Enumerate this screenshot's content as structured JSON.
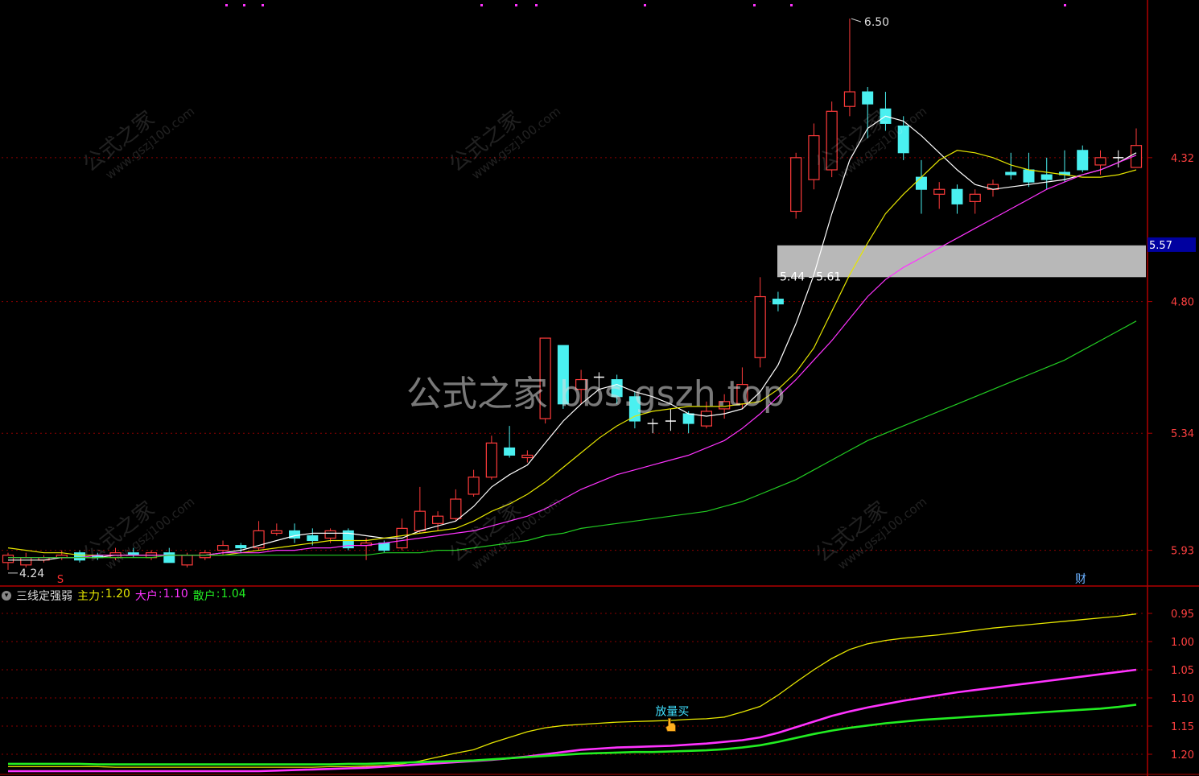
{
  "main_panel": {
    "axis_labels": [
      "5.93",
      "5.34",
      "4.80",
      "4.32"
    ],
    "current_price_tag": "5.57",
    "high_label": "6.50",
    "low_label": "4.24",
    "zone_label": "5.44 - 5.61",
    "zone": [
      5.44,
      5.61
    ],
    "marker_s": "S",
    "marker_cai": "财"
  },
  "sub_panel": {
    "indicator_name": "三线定强弱",
    "series_legend": [
      {
        "label": "主力",
        "value": "1.20",
        "color": "#e6e600"
      },
      {
        "label": "大户",
        "value": "1.10",
        "color": "#ff33ff"
      },
      {
        "label": "散户",
        "value": "1.04",
        "color": "#22ee22"
      }
    ],
    "axis_labels": [
      "1.20",
      "1.15",
      "1.10",
      "1.05",
      "1.00",
      "0.95"
    ],
    "signal_label": "放量买"
  },
  "watermarks": {
    "small_title": "公式之家",
    "small_url": "www.gszj100.com",
    "center_text": "公式之家 bbs.gszh.top"
  },
  "colors": {
    "up": "#ff3b3b",
    "down": "#4af0f0",
    "ma5": "#ffffff",
    "ma10": "#e6e600",
    "ma20": "#ff33ff",
    "ma60": "#22cc22",
    "grid": "#8a0000",
    "zone": "#c8c8c8"
  },
  "chart_data": [
    {
      "type": "candlestick",
      "title": "",
      "ylim": [
        4.2,
        6.55
      ],
      "axis_ticks": [
        4.32,
        4.8,
        5.34,
        5.93
      ],
      "candles": [
        [
          4.27,
          4.3,
          4.31,
          4.24
        ],
        [
          4.26,
          4.29,
          4.31,
          4.25
        ],
        [
          4.28,
          4.29,
          4.3,
          4.27
        ],
        [
          4.29,
          4.3,
          4.32,
          4.28
        ],
        [
          4.31,
          4.28,
          4.32,
          4.27
        ],
        [
          4.3,
          4.29,
          4.31,
          4.28
        ],
        [
          4.29,
          4.31,
          4.33,
          4.28
        ],
        [
          4.31,
          4.3,
          4.33,
          4.29
        ],
        [
          4.29,
          4.31,
          4.32,
          4.28
        ],
        [
          4.31,
          4.27,
          4.33,
          4.27
        ],
        [
          4.26,
          4.3,
          4.31,
          4.25
        ],
        [
          4.29,
          4.31,
          4.32,
          4.28
        ],
        [
          4.32,
          4.34,
          4.36,
          4.3
        ],
        [
          4.34,
          4.33,
          4.35,
          4.31
        ],
        [
          4.33,
          4.4,
          4.44,
          4.32
        ],
        [
          4.39,
          4.4,
          4.43,
          4.38
        ],
        [
          4.4,
          4.37,
          4.43,
          4.35
        ],
        [
          4.38,
          4.36,
          4.41,
          4.34
        ],
        [
          4.37,
          4.4,
          4.41,
          4.35
        ],
        [
          4.4,
          4.33,
          4.41,
          4.32
        ],
        [
          4.34,
          4.35,
          4.37,
          4.28
        ],
        [
          4.35,
          4.32,
          4.36,
          4.31
        ],
        [
          4.33,
          4.41,
          4.45,
          4.32
        ],
        [
          4.4,
          4.48,
          4.58,
          4.39
        ],
        [
          4.43,
          4.46,
          4.48,
          4.4
        ],
        [
          4.45,
          4.53,
          4.57,
          4.44
        ],
        [
          4.55,
          4.62,
          4.65,
          4.54
        ],
        [
          4.62,
          4.76,
          4.79,
          4.61
        ],
        [
          4.74,
          4.71,
          4.83,
          4.7
        ],
        [
          4.7,
          4.71,
          4.73,
          4.68
        ],
        [
          4.86,
          5.19,
          5.19,
          4.84
        ],
        [
          5.16,
          4.92,
          5.16,
          4.9
        ],
        [
          4.98,
          5.02,
          5.06,
          4.92
        ],
        [
          5.03,
          5.03,
          5.05,
          4.98
        ],
        [
          5.02,
          4.95,
          5.04,
          4.92
        ],
        [
          4.95,
          4.85,
          4.97,
          4.82
        ],
        [
          4.84,
          4.84,
          4.86,
          4.8
        ],
        [
          4.85,
          4.85,
          4.9,
          4.81
        ],
        [
          4.88,
          4.84,
          4.89,
          4.8
        ],
        [
          4.83,
          4.89,
          4.93,
          4.82
        ],
        [
          4.9,
          4.93,
          4.96,
          4.86
        ],
        [
          4.92,
          5.0,
          5.07,
          4.9
        ],
        [
          5.11,
          5.36,
          5.44,
          5.07
        ],
        [
          5.35,
          5.33,
          5.38,
          5.3
        ],
        [
          5.71,
          5.93,
          5.95,
          5.68
        ],
        [
          5.84,
          6.02,
          6.07,
          5.8
        ],
        [
          5.88,
          6.12,
          6.16,
          5.85
        ],
        [
          6.14,
          6.2,
          6.5,
          6.1
        ],
        [
          6.2,
          6.15,
          6.22,
          6.01
        ],
        [
          6.13,
          6.07,
          6.2,
          6.04
        ],
        [
          6.06,
          5.95,
          6.1,
          5.92
        ],
        [
          5.85,
          5.8,
          5.92,
          5.7
        ],
        [
          5.78,
          5.8,
          5.83,
          5.72
        ],
        [
          5.8,
          5.74,
          5.82,
          5.7
        ],
        [
          5.75,
          5.78,
          5.8,
          5.7
        ],
        [
          5.8,
          5.82,
          5.84,
          5.77
        ],
        [
          5.87,
          5.86,
          5.95,
          5.84
        ],
        [
          5.88,
          5.83,
          5.95,
          5.81
        ],
        [
          5.86,
          5.84,
          5.93,
          5.8
        ],
        [
          5.87,
          5.86,
          5.96,
          5.83
        ],
        [
          5.96,
          5.88,
          5.98,
          5.87
        ],
        [
          5.9,
          5.93,
          5.96,
          5.86
        ],
        [
          5.93,
          5.93,
          5.96,
          5.89
        ],
        [
          5.89,
          5.98,
          6.05,
          5.89
        ]
      ],
      "ma_lines": [
        {
          "key": "ma5",
          "values": [
            4.28,
            4.28,
            4.28,
            4.29,
            4.29,
            4.29,
            4.3,
            4.3,
            4.3,
            4.3,
            4.3,
            4.3,
            4.31,
            4.32,
            4.34,
            4.36,
            4.38,
            4.39,
            4.39,
            4.39,
            4.38,
            4.37,
            4.37,
            4.4,
            4.42,
            4.44,
            4.5,
            4.58,
            4.63,
            4.67,
            4.76,
            4.85,
            4.92,
            4.98,
            5.0,
            4.97,
            4.95,
            4.92,
            4.88,
            4.87,
            4.88,
            4.9,
            4.97,
            5.08,
            5.25,
            5.45,
            5.7,
            5.92,
            6.05,
            6.1,
            6.08,
            6.02,
            5.95,
            5.88,
            5.82,
            5.8,
            5.81,
            5.82,
            5.83,
            5.84,
            5.86,
            5.88,
            5.91,
            5.95
          ]
        },
        {
          "key": "ma10",
          "values": [
            4.33,
            4.32,
            4.31,
            4.31,
            4.3,
            4.3,
            4.3,
            4.3,
            4.3,
            4.3,
            4.3,
            4.3,
            4.3,
            4.31,
            4.32,
            4.33,
            4.34,
            4.35,
            4.36,
            4.36,
            4.36,
            4.37,
            4.38,
            4.39,
            4.4,
            4.41,
            4.44,
            4.48,
            4.51,
            4.55,
            4.6,
            4.66,
            4.72,
            4.78,
            4.83,
            4.87,
            4.89,
            4.9,
            4.91,
            4.91,
            4.91,
            4.92,
            4.93,
            4.98,
            5.05,
            5.15,
            5.3,
            5.45,
            5.58,
            5.7,
            5.78,
            5.85,
            5.92,
            5.96,
            5.95,
            5.93,
            5.9,
            5.88,
            5.87,
            5.86,
            5.85,
            5.85,
            5.86,
            5.88
          ]
        },
        {
          "key": "ma20",
          "values": [
            4.29,
            4.29,
            4.29,
            4.29,
            4.29,
            4.3,
            4.3,
            4.3,
            4.3,
            4.3,
            4.3,
            4.3,
            4.31,
            4.31,
            4.31,
            4.32,
            4.32,
            4.33,
            4.33,
            4.34,
            4.34,
            4.35,
            4.36,
            4.37,
            4.38,
            4.39,
            4.4,
            4.42,
            4.44,
            4.46,
            4.49,
            4.53,
            4.57,
            4.6,
            4.63,
            4.65,
            4.67,
            4.69,
            4.71,
            4.74,
            4.77,
            4.82,
            4.88,
            4.95,
            5.02,
            5.1,
            5.18,
            5.27,
            5.36,
            5.43,
            5.48,
            5.52,
            5.56,
            5.6,
            5.64,
            5.68,
            5.72,
            5.76,
            5.8,
            5.83,
            5.86,
            5.88,
            5.91,
            5.94
          ]
        },
        {
          "key": "ma60",
          "values": [
            4.29,
            4.29,
            4.29,
            4.29,
            4.29,
            4.29,
            4.29,
            4.29,
            4.29,
            4.3,
            4.3,
            4.3,
            4.3,
            4.3,
            4.3,
            4.3,
            4.3,
            4.3,
            4.3,
            4.3,
            4.3,
            4.31,
            4.31,
            4.31,
            4.32,
            4.32,
            4.33,
            4.34,
            4.35,
            4.36,
            4.38,
            4.39,
            4.41,
            4.42,
            4.43,
            4.44,
            4.45,
            4.46,
            4.47,
            4.48,
            4.5,
            4.52,
            4.55,
            4.58,
            4.61,
            4.65,
            4.69,
            4.73,
            4.77,
            4.8,
            4.83,
            4.86,
            4.89,
            4.92,
            4.95,
            4.98,
            5.01,
            5.04,
            5.07,
            5.1,
            5.14,
            5.18,
            5.22,
            5.26
          ]
        }
      ]
    },
    {
      "type": "line",
      "title": "三线定强弱",
      "ylim": [
        0.92,
        1.22
      ],
      "axis_ticks": [
        0.95,
        1.0,
        1.05,
        1.1,
        1.15,
        1.2
      ],
      "series": [
        {
          "name": "主力",
          "key": "zl",
          "values": [
            0.928,
            0.928,
            0.928,
            0.928,
            0.928,
            0.928,
            0.927,
            0.927,
            0.927,
            0.927,
            0.927,
            0.927,
            0.927,
            0.927,
            0.927,
            0.927,
            0.927,
            0.927,
            0.928,
            0.928,
            0.929,
            0.93,
            0.933,
            0.938,
            0.945,
            0.952,
            0.958,
            0.97,
            0.98,
            0.99,
            0.997,
            1.001,
            1.003,
            1.005,
            1.007,
            1.008,
            1.009,
            1.01,
            1.012,
            1.013,
            1.016,
            1.025,
            1.035,
            1.055,
            1.078,
            1.1,
            1.12,
            1.136,
            1.146,
            1.152,
            1.156,
            1.159,
            1.162,
            1.166,
            1.17,
            1.174,
            1.177,
            1.18,
            1.183,
            1.186,
            1.189,
            1.192,
            1.195,
            1.199
          ]
        },
        {
          "name": "大户",
          "key": "dh",
          "values": [
            0.92,
            0.92,
            0.92,
            0.92,
            0.92,
            0.92,
            0.92,
            0.92,
            0.92,
            0.92,
            0.92,
            0.92,
            0.92,
            0.92,
            0.92,
            0.921,
            0.922,
            0.923,
            0.924,
            0.925,
            0.926,
            0.928,
            0.93,
            0.932,
            0.934,
            0.936,
            0.938,
            0.94,
            0.943,
            0.946,
            0.95,
            0.954,
            0.958,
            0.96,
            0.962,
            0.963,
            0.964,
            0.965,
            0.967,
            0.969,
            0.972,
            0.975,
            0.98,
            0.988,
            0.998,
            1.008,
            1.018,
            1.026,
            1.033,
            1.039,
            1.045,
            1.05,
            1.055,
            1.06,
            1.064,
            1.068,
            1.072,
            1.076,
            1.08,
            1.084,
            1.088,
            1.092,
            1.096,
            1.1
          ]
        },
        {
          "name": "散户",
          "key": "sh",
          "values": [
            0.933,
            0.933,
            0.933,
            0.933,
            0.933,
            0.932,
            0.932,
            0.932,
            0.932,
            0.932,
            0.932,
            0.932,
            0.932,
            0.932,
            0.932,
            0.932,
            0.932,
            0.932,
            0.932,
            0.933,
            0.933,
            0.934,
            0.935,
            0.936,
            0.937,
            0.938,
            0.939,
            0.941,
            0.943,
            0.945,
            0.947,
            0.949,
            0.951,
            0.952,
            0.953,
            0.954,
            0.954,
            0.955,
            0.956,
            0.957,
            0.959,
            0.962,
            0.966,
            0.972,
            0.979,
            0.986,
            0.992,
            0.997,
            1.001,
            1.005,
            1.008,
            1.011,
            1.013,
            1.015,
            1.017,
            1.019,
            1.021,
            1.023,
            1.025,
            1.027,
            1.029,
            1.031,
            1.034,
            1.038
          ]
        }
      ]
    }
  ]
}
